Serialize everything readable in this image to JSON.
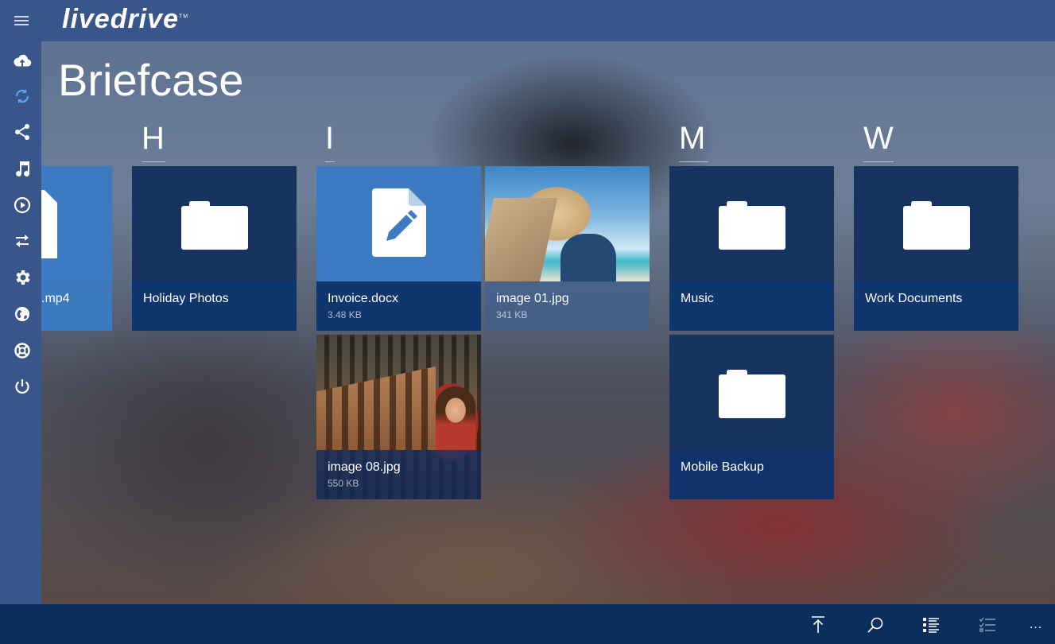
{
  "app": {
    "brand": "livedrive",
    "trademark": "TM",
    "page_title": "Briefcase"
  },
  "sidebar": {
    "items": [
      {
        "icon": "cloud-upload-icon"
      },
      {
        "icon": "sync-icon"
      },
      {
        "icon": "share-icon"
      },
      {
        "icon": "music-icon"
      },
      {
        "icon": "play-icon"
      },
      {
        "icon": "transfer-icon"
      },
      {
        "icon": "settings-icon"
      },
      {
        "icon": "globe-icon"
      },
      {
        "icon": "help-icon"
      },
      {
        "icon": "power-icon"
      }
    ]
  },
  "groups": [
    {
      "letter": "H"
    },
    {
      "letter": "I"
    },
    {
      "letter": "M"
    },
    {
      "letter": "W"
    }
  ],
  "tiles": {
    "partial": {
      "name": ".mp4",
      "type": "file"
    },
    "holiday_photos": {
      "name": "Holiday Photos",
      "type": "folder"
    },
    "invoice": {
      "name": "Invoice.docx",
      "size": "3.48 KB",
      "type": "document"
    },
    "image01": {
      "name": "image 01.jpg",
      "size": "341 KB",
      "type": "image"
    },
    "image08": {
      "name": "image 08.jpg",
      "size": "550 KB",
      "type": "image"
    },
    "music": {
      "name": "Music",
      "type": "folder"
    },
    "mobile_backup": {
      "name": "Mobile Backup",
      "type": "folder"
    },
    "work_documents": {
      "name": "Work Documents",
      "type": "folder"
    }
  },
  "bottombar": {
    "actions": [
      {
        "icon": "upload-icon"
      },
      {
        "icon": "search-icon"
      },
      {
        "icon": "list-view-icon"
      },
      {
        "icon": "select-icon"
      },
      {
        "icon": "more-icon",
        "label": "..."
      }
    ]
  },
  "colors": {
    "header": "#38568a",
    "bottombar": "#0b2f5c",
    "tile_label": "#0a326e",
    "folder_tile": "#17335f",
    "doc_tile": "#3c7ac2"
  }
}
